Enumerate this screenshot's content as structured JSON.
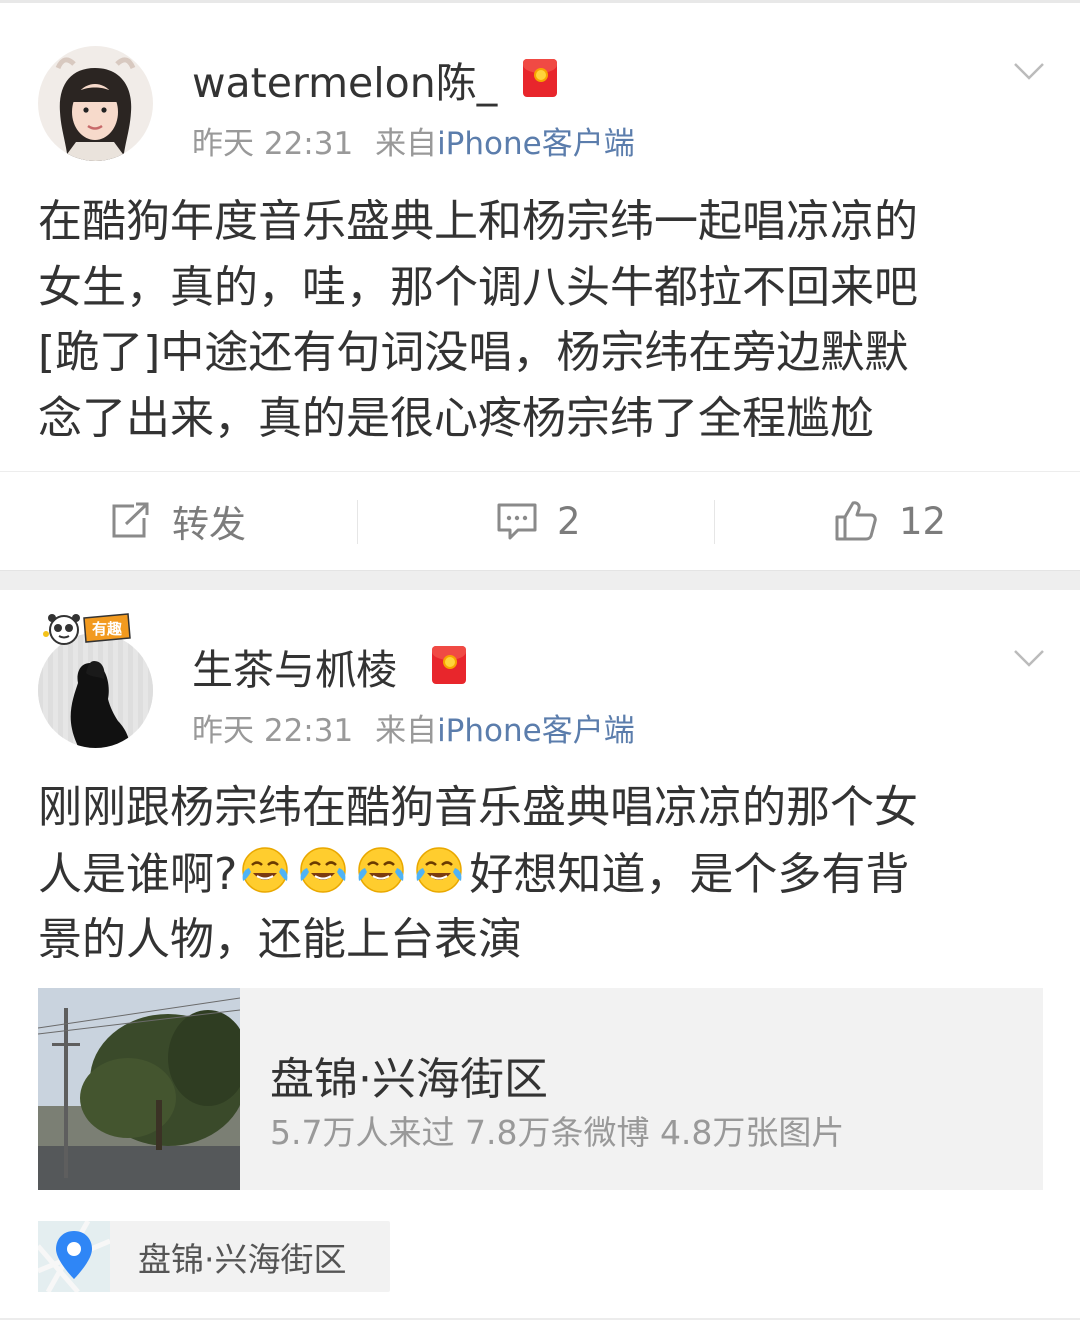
{
  "posts": [
    {
      "username": "watermelon陈_",
      "time": "昨天 22:31",
      "source_prefix": "来自",
      "source": "iPhone客户端",
      "lines": [
        "在酷狗年度音乐盛典上和杨宗纬一起唱凉凉的",
        "女生，真的，哇，那个调八头牛都拉不回来吧",
        "[跪了]中途还有句词没唱，杨宗纬在旁边默默",
        "念了出来，真的是很心疼杨宗纬了全程尴尬"
      ],
      "actions": {
        "repost": "转发",
        "comments": "2",
        "likes": "12"
      }
    },
    {
      "username": "生茶与枛棱",
      "avatar_badge": "有趣",
      "time": "昨天 22:31",
      "source_prefix": "来自",
      "source": "iPhone客户端",
      "line1": "刚刚跟杨宗纬在酷狗音乐盛典唱凉凉的那个女",
      "line2_before": "人是谁啊?",
      "line2_after": "好想知道，是个多有背",
      "line3": "景的人物，还能上台表演",
      "emoji": "laugh-cry-icon",
      "emoji_count": 4,
      "location_card": {
        "title": "盘锦·兴海街区",
        "stats": "5.7万人来过 7.8万条微博 4.8万张图片"
      },
      "location_chip": "盘锦·兴海街区"
    }
  ],
  "colors": {
    "source_link": "#5b7dac",
    "meta": "#999999",
    "red_packet": "#e8262c",
    "map_pin": "#2f86f6"
  }
}
